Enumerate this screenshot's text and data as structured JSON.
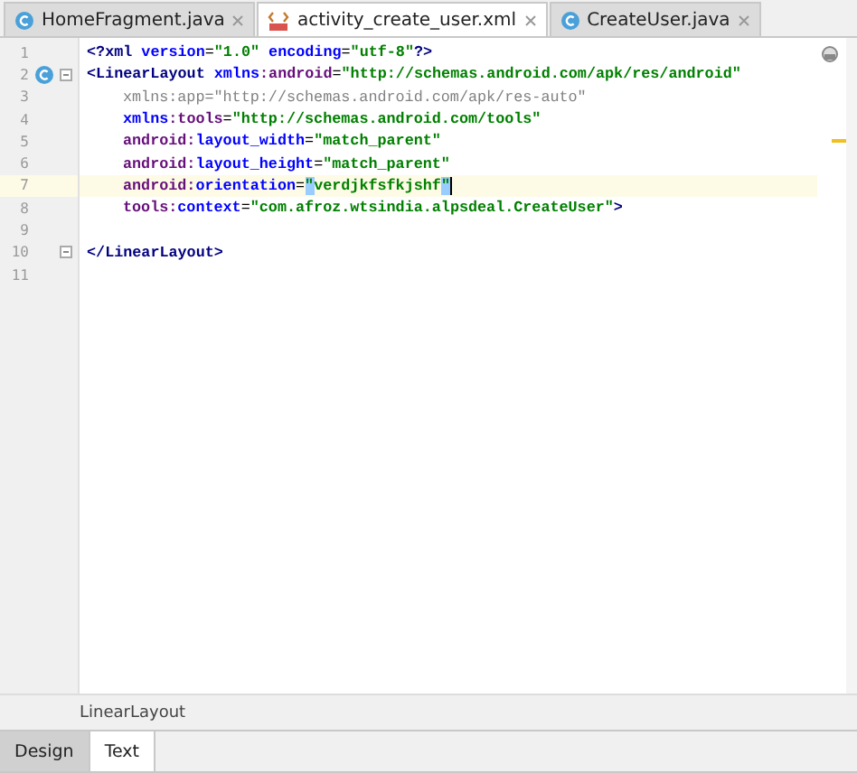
{
  "tabs": [
    {
      "label": "HomeFragment.java",
      "kind": "class",
      "selected": false
    },
    {
      "label": "activity_create_user.xml",
      "kind": "xml",
      "selected": true
    },
    {
      "label": "CreateUser.java",
      "kind": "class",
      "selected": false
    }
  ],
  "lines": [
    {
      "number": "1",
      "current": false,
      "fold": false,
      "tokens": [
        {
          "kind": "punct",
          "text": "<?"
        },
        {
          "kind": "tag",
          "text": "xml "
        },
        {
          "kind": "attr",
          "text": "version"
        },
        {
          "kind": "plain",
          "text": "="
        },
        {
          "kind": "value",
          "text": "\"1.0\" "
        },
        {
          "kind": "attr",
          "text": "encoding"
        },
        {
          "kind": "plain",
          "text": "="
        },
        {
          "kind": "value",
          "text": "\"utf-8\""
        },
        {
          "kind": "punct",
          "text": "?>"
        }
      ]
    },
    {
      "number": "2",
      "kind": "class",
      "current": false,
      "fold": true,
      "tokens": [
        {
          "kind": "punct",
          "text": "<"
        },
        {
          "kind": "tag",
          "text": "LinearLayout "
        },
        {
          "kind": "attr",
          "text": "xmlns"
        },
        {
          "kind": "ns",
          "text": ":android"
        },
        {
          "kind": "plain",
          "text": "="
        },
        {
          "kind": "value",
          "text": "\"http://schemas.android.com/apk/res/android\""
        }
      ],
      "children": [
        {
          "number": "3",
          "current": false,
          "fold": false,
          "tokens": [
            {
              "kind": "unused",
              "text": "xmlns:app=\"http://schemas.android.com/apk/res-auto\""
            }
          ]
        },
        {
          "number": "4",
          "current": false,
          "fold": false,
          "tokens": [
            {
              "kind": "attr",
              "text": "xmlns"
            },
            {
              "kind": "ns",
              "text": ":tools"
            },
            {
              "kind": "plain",
              "text": "="
            },
            {
              "kind": "value",
              "text": "\"http://schemas.android.com/tools\""
            }
          ]
        },
        {
          "number": "5",
          "current": false,
          "fold": false,
          "tokens": [
            {
              "kind": "ns",
              "text": "android:"
            },
            {
              "kind": "attr",
              "text": "layout_width"
            },
            {
              "kind": "plain",
              "text": "="
            },
            {
              "kind": "value",
              "text": "\"match_parent\""
            }
          ]
        },
        {
          "number": "6",
          "current": false,
          "fold": false,
          "tokens": [
            {
              "kind": "ns",
              "text": "android:"
            },
            {
              "kind": "attr",
              "text": "layout_height"
            },
            {
              "kind": "plain",
              "text": "="
            },
            {
              "kind": "value",
              "text": "\"match_parent\""
            }
          ]
        },
        {
          "number": "7",
          "current": true,
          "fold": false,
          "tokens": [
            {
              "kind": "ns",
              "text": "android:"
            },
            {
              "kind": "attr",
              "text": "orientation"
            },
            {
              "kind": "plain",
              "text": "="
            },
            {
              "kind": "match",
              "text": "\""
            },
            {
              "kind": "value",
              "text": "verdjkfsfkjshf"
            },
            {
              "kind": "match",
              "text": "\""
            }
          ]
        },
        {
          "number": "8",
          "current": false,
          "fold": false,
          "tokens": [
            {
              "kind": "ns",
              "text": "tools:"
            },
            {
              "kind": "attr",
              "text": "context"
            },
            {
              "kind": "plain",
              "text": "="
            },
            {
              "kind": "value",
              "text": "\"com.afroz.wtsindia.alpsdeal.CreateUser\""
            },
            {
              "kind": "punct",
              "text": ">"
            }
          ]
        }
      ]
    },
    {
      "number": "9",
      "current": false,
      "fold": false
    },
    {
      "number": "10",
      "current": false,
      "fold": true,
      "tokens": [
        {
          "kind": "punct",
          "text": "</"
        },
        {
          "kind": "tag",
          "text": "LinearLayout"
        },
        {
          "kind": "punct",
          "text": ">"
        }
      ]
    },
    {
      "number": "11",
      "current": false,
      "fold": false
    }
  ],
  "breadcrumb": "LinearLayout",
  "bottom_tabs": [
    {
      "label": "Design",
      "selected": false
    },
    {
      "label": "Text",
      "selected": true
    }
  ]
}
